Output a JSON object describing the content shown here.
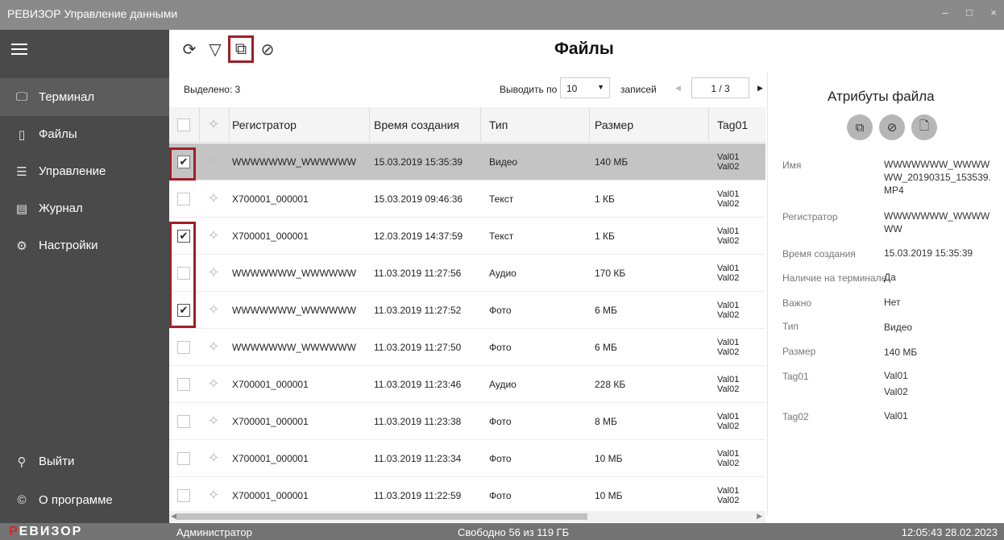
{
  "window": {
    "title": "РЕВИЗОР Управление данными",
    "controls": [
      "–",
      "□",
      "×"
    ]
  },
  "sidebar": {
    "menu_icon": "hamburger-menu-icon",
    "items": [
      {
        "label": "Терминал",
        "icon": "terminal-icon",
        "active": true
      },
      {
        "label": "Файлы",
        "icon": "files-icon",
        "active": false
      },
      {
        "label": "Управление",
        "icon": "sliders-icon",
        "active": false
      },
      {
        "label": "Журнал",
        "icon": "journal-icon",
        "active": false
      },
      {
        "label": "Настройки",
        "icon": "gear-icon",
        "active": false
      }
    ],
    "bottom_items": [
      {
        "label": "Выйти",
        "icon": "user-icon"
      },
      {
        "label": "О программе",
        "icon": "copyright-icon"
      }
    ]
  },
  "toolbar": {
    "page_title": "Файлы",
    "buttons": [
      "refresh-icon",
      "filter-icon",
      "copy-icon",
      "tag-icon"
    ]
  },
  "selection": {
    "selected_label": "Выделено: 3",
    "per_page_label": "Выводить по",
    "per_page_value": "10",
    "records_label": "записей",
    "page_indicator": "1 / 3"
  },
  "table": {
    "columns": [
      "Регистратор",
      "Время создания",
      "Тип",
      "Размер",
      "Tag01"
    ],
    "rows": [
      {
        "checked": true,
        "active": true,
        "registrar": "WWWWWWW_WWWWWW",
        "time": "15.03.2019 15:35:39",
        "type": "Видео",
        "size": "140 МБ",
        "tag1": "Val01",
        "tag2": "Val02"
      },
      {
        "checked": false,
        "active": false,
        "registrar": "X700001_000001",
        "time": "15.03.2019 09:46:36",
        "type": "Текст",
        "size": "1 КБ",
        "tag1": "Val01",
        "tag2": "Val02"
      },
      {
        "checked": true,
        "active": false,
        "registrar": "X700001_000001",
        "time": "12.03.2019 14:37:59",
        "type": "Текст",
        "size": "1 КБ",
        "tag1": "Val01",
        "tag2": "Val02"
      },
      {
        "checked": false,
        "active": false,
        "registrar": "WWWWWWW_WWWWWW",
        "time": "11.03.2019 11:27:56",
        "type": "Аудио",
        "size": "170 КБ",
        "tag1": "Val01",
        "tag2": "Val02"
      },
      {
        "checked": true,
        "active": false,
        "registrar": "WWWWWWW_WWWWWW",
        "time": "11.03.2019 11:27:52",
        "type": "Фото",
        "size": "6 МБ",
        "tag1": "Val01",
        "tag2": "Val02"
      },
      {
        "checked": false,
        "active": false,
        "registrar": "WWWWWWW_WWWWWW",
        "time": "11.03.2019 11:27:50",
        "type": "Фото",
        "size": "6 МБ",
        "tag1": "Val01",
        "tag2": "Val02"
      },
      {
        "checked": false,
        "active": false,
        "registrar": "X700001_000001",
        "time": "11.03.2019 11:23:46",
        "type": "Аудио",
        "size": "228 КБ",
        "tag1": "Val01",
        "tag2": "Val02"
      },
      {
        "checked": false,
        "active": false,
        "registrar": "X700001_000001",
        "time": "11.03.2019 11:23:38",
        "type": "Фото",
        "size": "8 МБ",
        "tag1": "Val01",
        "tag2": "Val02"
      },
      {
        "checked": false,
        "active": false,
        "registrar": "X700001_000001",
        "time": "11.03.2019 11:23:34",
        "type": "Фото",
        "size": "10 МБ",
        "tag1": "Val01",
        "tag2": "Val02"
      },
      {
        "checked": false,
        "active": false,
        "registrar": "X700001_000001",
        "time": "11.03.2019 11:22:59",
        "type": "Фото",
        "size": "10 МБ",
        "tag1": "Val01",
        "tag2": "Val02"
      }
    ]
  },
  "attributes": {
    "title": "Атрибуты файла",
    "buttons": [
      "copy-icon",
      "tag-icon",
      "export-file-icon"
    ],
    "fields": [
      {
        "key": "Имя",
        "value": "WWWWWWW_WWWWWW_20190315_153539.MP4"
      },
      {
        "key": "Регистратор",
        "value": "WWWWWWW_WWWWWW"
      },
      {
        "key": "Время создания",
        "value": "15.03.2019 15:35:39"
      },
      {
        "key": "Наличие на терминале",
        "value": "Да"
      },
      {
        "key": "Важно",
        "value": "Нет"
      },
      {
        "key": "Тип",
        "value": "Видео"
      },
      {
        "key": "Размер",
        "value": "140 МБ"
      },
      {
        "key": "Tag01",
        "value": "Val01",
        "value2": "Val02"
      },
      {
        "key": "Tag02",
        "value": "Val01"
      }
    ]
  },
  "status": {
    "logo": "РЕВИЗОР",
    "user": "Администратор",
    "free_space": "Свободно 56 из 119 ГБ",
    "datetime": "12:05:43 28.02.2023"
  },
  "colors": {
    "sidebar": "#4a4a4a",
    "titlebar": "#8a8a8a",
    "highlight": "#a01e25",
    "row_selected": "#c4c4c4"
  }
}
